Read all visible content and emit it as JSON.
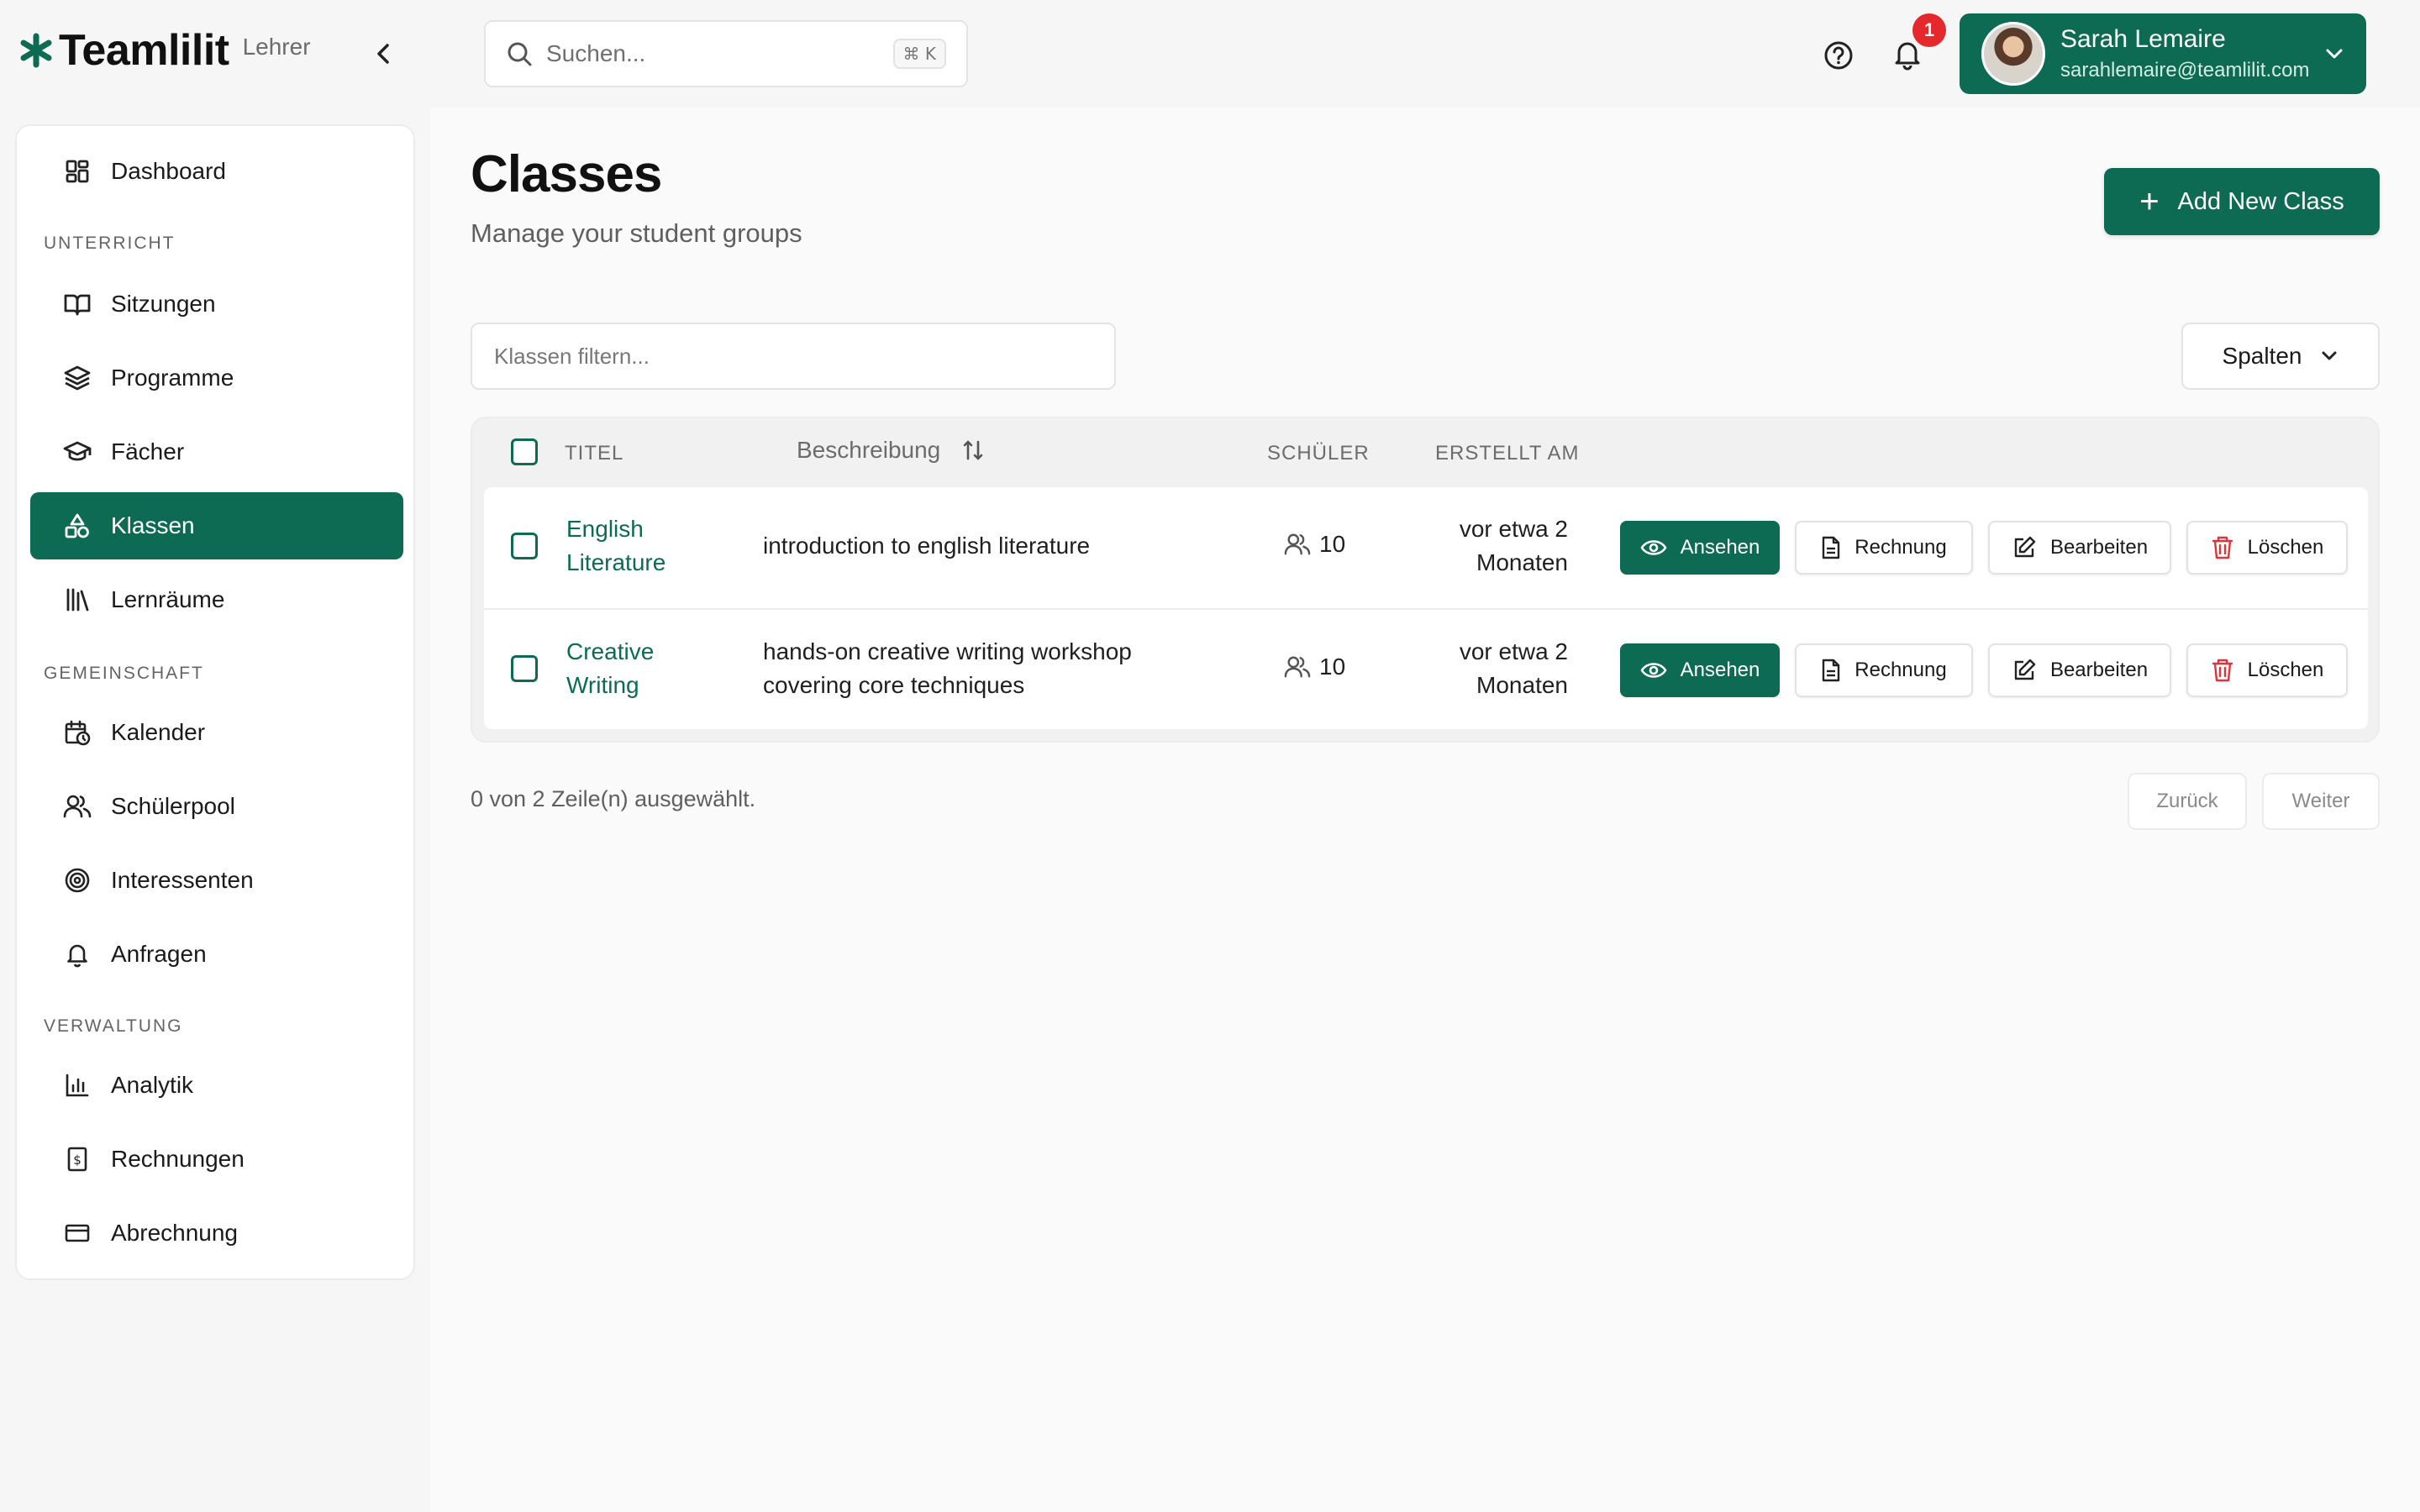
{
  "brand": {
    "name": "Teamlilit",
    "role": "Lehrer",
    "logo_icon": "asterisk-logo-icon"
  },
  "search": {
    "placeholder": "Suchen...",
    "shortcut": "⌘ K"
  },
  "notifications": {
    "count": "1"
  },
  "user": {
    "name": "Sarah Lemaire",
    "email": "sarahlemaire@teamlilit.com"
  },
  "colors": {
    "primary": "#0c6b52",
    "badge": "#e5282b",
    "danger": "#e0343a"
  },
  "sidebar": {
    "top_items": [
      {
        "label": "Dashboard",
        "icon": "dashboard-icon"
      }
    ],
    "sections": [
      {
        "title": "UNTERRICHT",
        "items": [
          {
            "label": "Sitzungen",
            "icon": "book-open-icon"
          },
          {
            "label": "Programme",
            "icon": "layers-icon"
          },
          {
            "label": "Fächer",
            "icon": "graduation-cap-icon"
          },
          {
            "label": "Klassen",
            "icon": "shapes-icon",
            "active": true
          },
          {
            "label": "Lernräume",
            "icon": "library-icon"
          }
        ]
      },
      {
        "title": "GEMEINSCHAFT",
        "items": [
          {
            "label": "Kalender",
            "icon": "calendar-clock-icon"
          },
          {
            "label": "Schülerpool",
            "icon": "users-icon"
          },
          {
            "label": "Interessenten",
            "icon": "target-icon"
          },
          {
            "label": "Anfragen",
            "icon": "bell-icon"
          }
        ]
      },
      {
        "title": "VERWALTUNG",
        "items": [
          {
            "label": "Analytik",
            "icon": "bar-chart-icon"
          },
          {
            "label": "Rechnungen",
            "icon": "receipt-icon"
          },
          {
            "label": "Abrechnung",
            "icon": "credit-card-icon"
          }
        ]
      }
    ]
  },
  "page": {
    "title": "Classes",
    "subtitle": "Manage your student groups",
    "add_button": "Add New Class",
    "filter_placeholder": "Klassen filtern...",
    "columns_button": "Spalten"
  },
  "table": {
    "headers": {
      "title": "TITEL",
      "description": "Beschreibung",
      "students": "SCHÜLER",
      "created": "ERSTELLT AM"
    },
    "actions": {
      "view": "Ansehen",
      "invoice": "Rechnung",
      "edit": "Bearbeiten",
      "delete": "Löschen"
    },
    "rows": [
      {
        "title_l1": "English",
        "title_l2": "Literature",
        "desc_l1": "introduction to english literature",
        "desc_l2": "",
        "students": "10",
        "created_l1": "vor etwa 2",
        "created_l2": "Monaten"
      },
      {
        "title_l1": "Creative",
        "title_l2": "Writing",
        "desc_l1": "hands-on creative writing workshop",
        "desc_l2": "covering core techniques",
        "students": "10",
        "created_l1": "vor etwa 2",
        "created_l2": "Monaten"
      }
    ]
  },
  "footer": {
    "selection": "0 von 2 Zeile(n) ausgewählt.",
    "prev": "Zurück",
    "next": "Weiter"
  }
}
